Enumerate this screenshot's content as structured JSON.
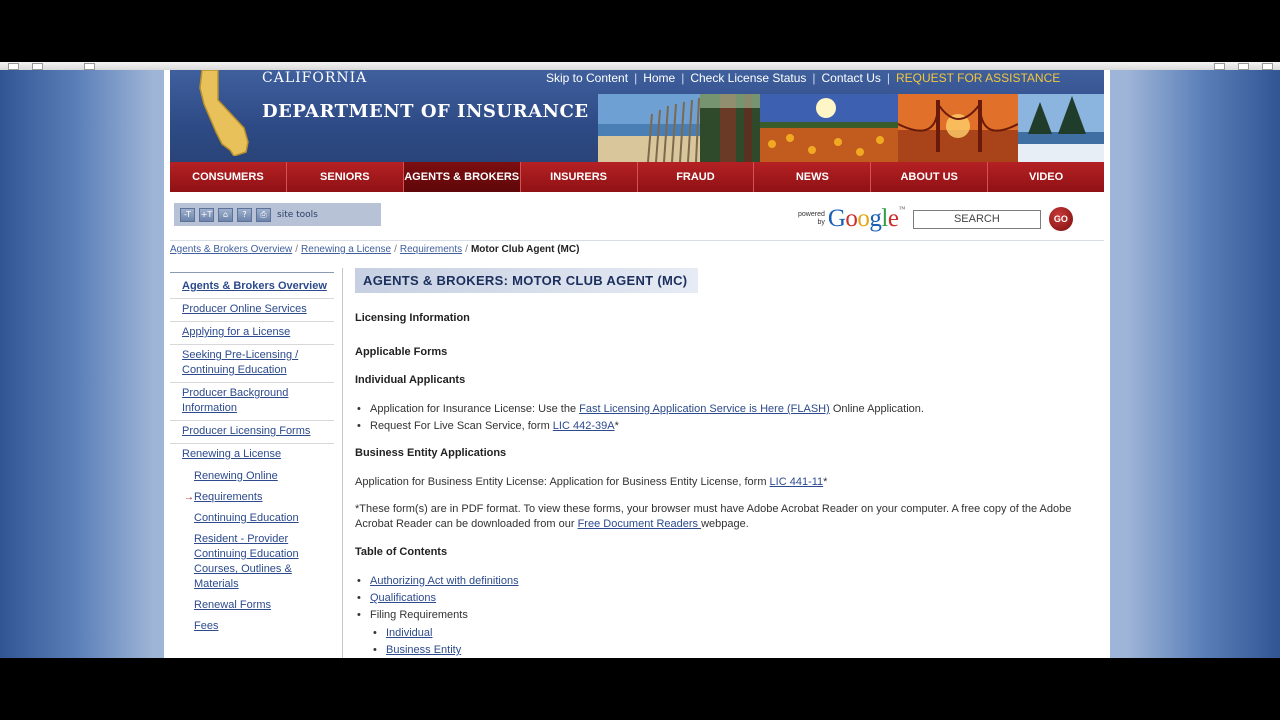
{
  "header": {
    "state_label": "CALIFORNIA",
    "dept_label": "DEPARTMENT OF INSURANCE",
    "top_links": [
      "Skip to Content",
      "Home",
      "Check License Status",
      "Contact Us"
    ],
    "assistance_link": "REQUEST FOR ASSISTANCE"
  },
  "nav": {
    "items": [
      "CONSUMERS",
      "SENIORS",
      "AGENTS & BROKERS",
      "INSURERS",
      "FRAUD",
      "NEWS",
      "ABOUT US",
      "VIDEO"
    ],
    "active_index": 2
  },
  "site_tools": {
    "label": "site tools",
    "buttons": [
      "-T",
      "+T",
      "sitemap-icon",
      "help-icon",
      "print-icon"
    ],
    "button_text": [
      "-T",
      "+T",
      "⌂",
      "?",
      "⎙"
    ]
  },
  "search": {
    "powered": "powered",
    "by": "by",
    "google_letters": [
      "G",
      "o",
      "o",
      "g",
      "l",
      "e"
    ],
    "tm": "™",
    "placeholder": "SEARCH",
    "go_label": "GO"
  },
  "breadcrumb": {
    "items": [
      "Agents & Brokers Overview",
      "Renewing a License",
      "Requirements"
    ],
    "current": "Motor Club Agent (MC)",
    "separator": "/"
  },
  "sidebar": {
    "main_items": [
      {
        "label": "Agents & Brokers Overview",
        "bold": true
      },
      {
        "label": "Producer Online Services",
        "bold": false
      },
      {
        "label": "Applying for a License",
        "bold": false
      },
      {
        "label": "Seeking Pre-Licensing / Continuing Education",
        "bold": false
      },
      {
        "label": "Producer Background Information",
        "bold": false
      },
      {
        "label": "Producer Licensing Forms",
        "bold": false
      },
      {
        "label": "Renewing a License",
        "bold": false
      }
    ],
    "sub_items": [
      {
        "label": "Renewing Online",
        "current": false
      },
      {
        "label": "Requirements",
        "current": true
      },
      {
        "label": "Continuing Education",
        "current": false
      },
      {
        "label": "Resident - Provider Continuing Education Courses, Outlines & Materials",
        "current": false
      },
      {
        "label": "Renewal Forms",
        "current": false
      },
      {
        "label": "Fees",
        "current": false
      }
    ],
    "current_marker": "→"
  },
  "content": {
    "title": "AGENTS & BROKERS: MOTOR CLUB AGENT (MC)",
    "licensing_info": "Licensing Information",
    "applicable_forms": "Applicable Forms",
    "individual_applicants": "Individual Applicants",
    "ind_item1": {
      "pre": "Application for Insurance License: Use the ",
      "link": "Fast Licensing Application Service is Here (FLASH)",
      "post": " Online Application."
    },
    "ind_item2": {
      "pre": "Request For Live Scan Service, form ",
      "link": "LIC 442-39A",
      "post": "*"
    },
    "business_heading": "Business Entity Applications",
    "business_text": {
      "pre": "Application for Business Entity License: Application for Business Entity License, form ",
      "link": "LIC 441-11",
      "post": "*"
    },
    "pdf_note": {
      "pre": "*These form(s) are in PDF format. To view these forms, your browser must have Adobe Acrobat Reader on your computer. A free copy of the Adobe Acrobat Reader can be downloaded from our ",
      "link": "Free Document Readers ",
      "post": " webpage."
    },
    "toc_heading": "Table of Contents",
    "toc": {
      "authorizing": "Authorizing Act with definitions",
      "qualifications": "Qualifications",
      "filing": "Filing Requirements",
      "individual": "Individual",
      "business_entity": "Business Entity"
    }
  },
  "colors": {
    "banner_blue": "#2e4b86",
    "nav_red": "#a3161a",
    "link_blue": "#2c4a8c",
    "assist_gold": "#f3c73d"
  }
}
